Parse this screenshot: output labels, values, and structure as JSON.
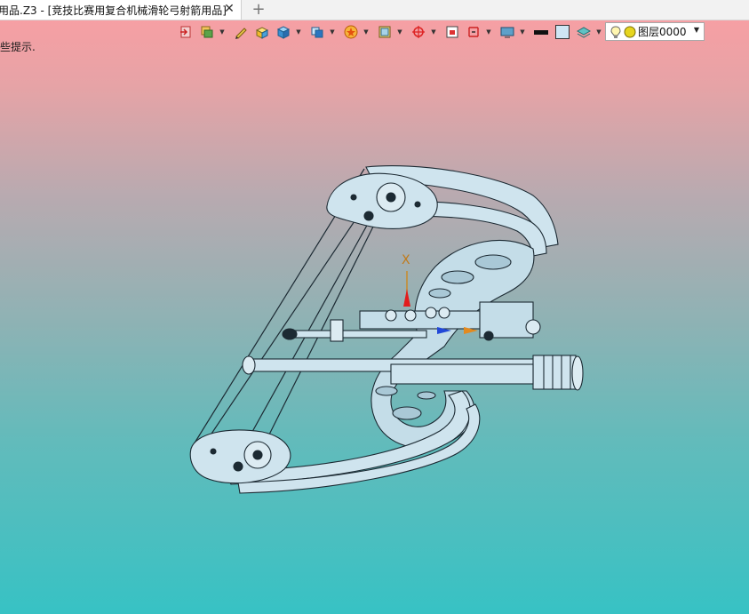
{
  "tab": {
    "title": "用品.Z3 - [竞技比赛用复合机械滑轮弓射箭用品]",
    "close_glyph": "✕",
    "add_glyph": "+"
  },
  "viewport": {
    "hint_text": "些提示.",
    "gizmo_axis_label": "X",
    "bg_top_color": "#fb9ea3",
    "bg_bottom_color": "#37c2c4"
  },
  "toolbar": {
    "buttons": [
      {
        "icon": "exit-icon"
      },
      {
        "icon": "layer-stack-icon"
      },
      {
        "icon": "pencil-icon"
      },
      {
        "icon": "shaded-box-icon"
      },
      {
        "icon": "blue-cube-icon"
      },
      {
        "icon": "view-cube-icon"
      },
      {
        "icon": "star-face-icon"
      },
      {
        "icon": "render-icon"
      },
      {
        "icon": "snap-crosshair-icon"
      },
      {
        "icon": "frame-icon"
      },
      {
        "icon": "section-icon"
      },
      {
        "icon": "display-icon"
      },
      {
        "icon": "line-color-icon"
      },
      {
        "icon": "face-color-icon"
      },
      {
        "icon": "layers-icon"
      }
    ],
    "layer_selector": {
      "value": "图层0000",
      "bulb_icon": "lightbulb-icon",
      "status_icon": "yellow-circle-icon"
    }
  }
}
